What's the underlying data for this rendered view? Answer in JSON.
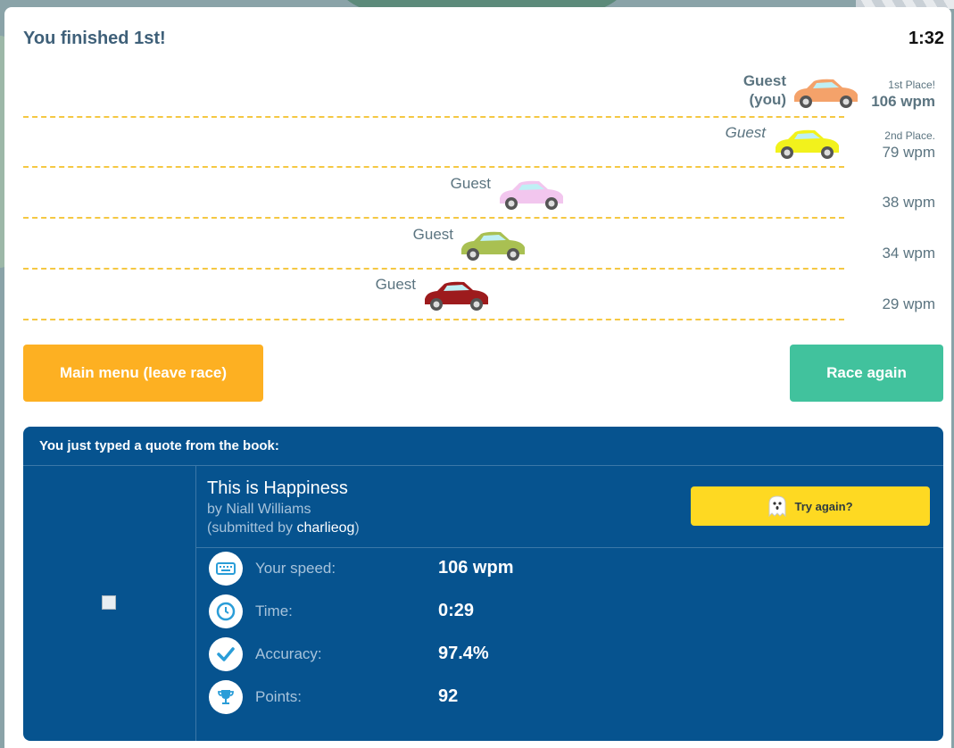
{
  "race": {
    "title": "You finished 1st!",
    "timer": "1:32",
    "racers": [
      {
        "name_line1": "Guest",
        "name_line2": "(you)",
        "place": "1st Place!",
        "wpm": "106 wpm",
        "car_color": "#f4a26a"
      },
      {
        "name_line1": "Guest",
        "place": "2nd Place.",
        "wpm": "79 wpm",
        "car_color": "#f2f21c"
      },
      {
        "name_line1": "Guest",
        "wpm": "38 wpm",
        "car_color": "#f2c6ee"
      },
      {
        "name_line1": "Guest",
        "wpm": "34 wpm",
        "car_color": "#a9c052"
      },
      {
        "name_line1": "Guest",
        "wpm": "29 wpm",
        "car_color": "#9d1b1d"
      }
    ]
  },
  "buttons": {
    "main_menu": "Main menu (leave race)",
    "race_again": "Race again"
  },
  "quote": {
    "header": "You just typed a quote from the book:",
    "book_title": "This is Happiness",
    "author": "by Niall Williams",
    "submitted_prefix": "(submitted by ",
    "submitted_user": "charlieog",
    "submitted_suffix": ")",
    "try_again": "Try again?"
  },
  "stats": [
    {
      "label": "Your speed:",
      "value": "106 wpm",
      "icon": "keyboard-icon"
    },
    {
      "label": "Time:",
      "value": "0:29",
      "icon": "clock-icon"
    },
    {
      "label": "Accuracy:",
      "value": "97.4%",
      "icon": "checkmark-icon"
    },
    {
      "label": "Points:",
      "value": "92",
      "icon": "trophy-icon"
    }
  ],
  "colors": {
    "menu_button": "#fdb022",
    "race_button": "#41c29d",
    "quote_panel": "#06538f",
    "try_button": "#fed922",
    "lane_dash": "#f5c843"
  }
}
